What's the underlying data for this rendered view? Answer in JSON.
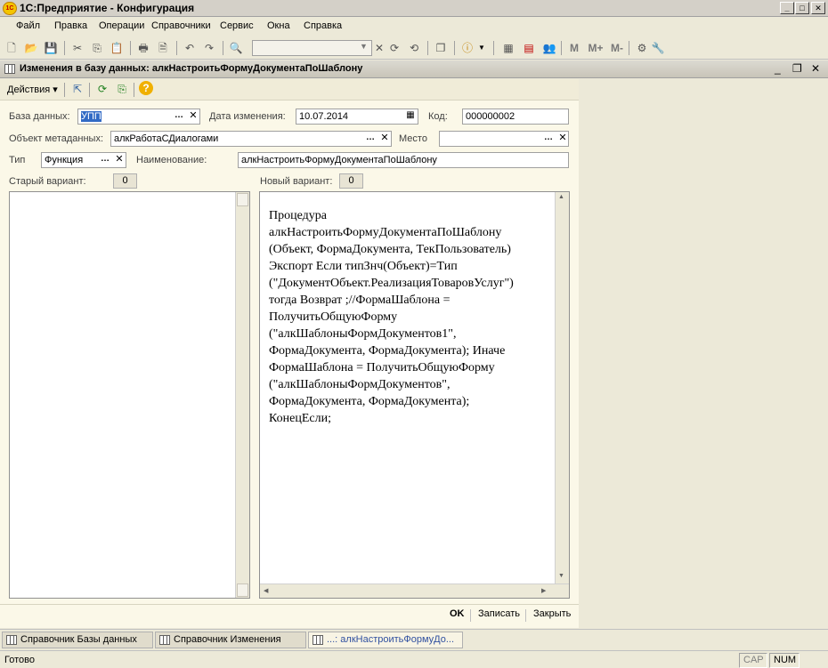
{
  "window": {
    "title": "1С:Предприятие - Конфигурация",
    "logo": "1С"
  },
  "menu": [
    "Файл",
    "Правка",
    "Операции",
    "Справочники",
    "Сервис",
    "Окна",
    "Справка"
  ],
  "toolbar": {
    "memory_buttons": [
      "M",
      "M+",
      "M-"
    ]
  },
  "child": {
    "title": "Изменения в базу данных: алкНастроитьФормуДокументаПоШаблону",
    "actions_label": "Действия"
  },
  "form": {
    "db_label": "База данных:",
    "db_value": "УПП",
    "date_label": "Дата изменения:",
    "date_value": "10.07.2014",
    "code_label": "Код:",
    "code_value": "000000002",
    "meta_label": "Объект метаданных:",
    "meta_value": "алкРаботаСДиалогами",
    "place_label": "Место",
    "place_value": "",
    "type_label": "Тип",
    "type_value": "Функция",
    "name_label": "Наименование:",
    "name_value": "алкНастроитьФормуДокументаПоШаблону",
    "old_label": "Старый вариант:",
    "old_count": "0",
    "new_label": "Новый вариант:",
    "new_count": "0",
    "new_text": "Процедура\nалкНастроитьФормуДокументаПоШаблону\n(Объект, ФормаДокумента, ТекПользователь)\nЭкспорт Если типЗнч(Объект)=Тип\n(\"ДокументОбъект.РеализацияТоваровУслуг\")\nтогда Возврат ;//ФормаШаблона =\nПолучитьОбщуюФорму\n(\"алкШаблоныФормДокументов1\",\nФормаДокумента, ФормаДокумента); Иначе\nФормаШаблона = ПолучитьОбщуюФорму\n(\"алкШаблоныФормДокументов\",\nФормаДокумента, ФормаДокумента);\nКонецЕсли;",
    "ok_label": "OK",
    "save_label": "Записать",
    "close_label": "Закрыть"
  },
  "taskbar": [
    "Справочник Базы данных",
    "Справочник Изменения",
    "...: алкНастроитьФормуДо..."
  ],
  "status": {
    "text": "Готово",
    "cap": "CAP",
    "num": "NUM"
  }
}
